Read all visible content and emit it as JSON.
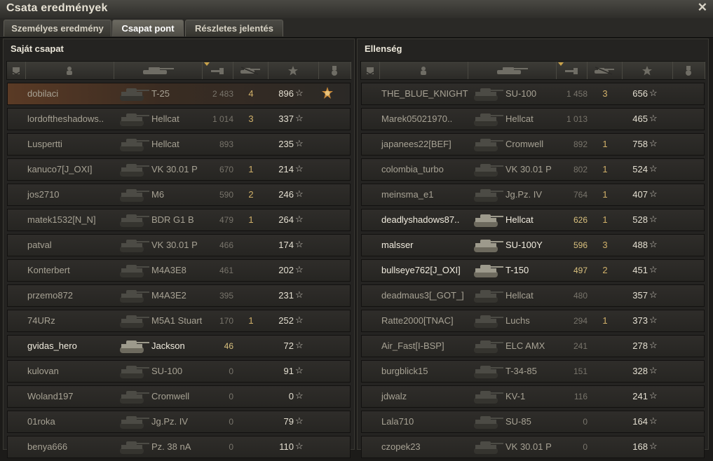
{
  "window": {
    "title": "Csata eredmények",
    "close_icon": "close-icon"
  },
  "tabs": [
    {
      "label": "Személyes eredmény",
      "active": false
    },
    {
      "label": "Csapat pont",
      "active": true
    },
    {
      "label": "Részletes jelentés",
      "active": false
    }
  ],
  "columns": {
    "icons": [
      "rank-icon",
      "player-icon",
      "tank-icon",
      "damage-icon",
      "kills-icon",
      "experience-star-icon",
      "medal-icon"
    ],
    "sorted_by": "damage-icon"
  },
  "colors": {
    "accent": "#c9a24a",
    "alive_text": "#f1ecdf",
    "dead_text": "#a7a294",
    "first_row": "#5a3a25"
  },
  "own_team": {
    "title": "Saját csapat",
    "players": [
      {
        "name": "dobilaci",
        "tank": "T-25",
        "damage": "2 483",
        "frags": "4",
        "xp": "896",
        "alive": false,
        "first": true,
        "medal": true
      },
      {
        "name": "lordoftheshadows..",
        "tank": "Hellcat",
        "damage": "1 014",
        "frags": "3",
        "xp": "337",
        "alive": false
      },
      {
        "name": "Luspertti",
        "tank": "Hellcat",
        "damage": "893",
        "frags": "",
        "xp": "235",
        "alive": false
      },
      {
        "name": "kanuco7[J_OXI]",
        "tank": "VK 30.01 P",
        "damage": "670",
        "frags": "1",
        "xp": "214",
        "alive": false
      },
      {
        "name": "jos2710",
        "tank": "M6",
        "damage": "590",
        "frags": "2",
        "xp": "246",
        "alive": false
      },
      {
        "name": "matek1532[N_N]",
        "tank": "BDR G1 B",
        "damage": "479",
        "frags": "1",
        "xp": "264",
        "alive": false
      },
      {
        "name": "patval",
        "tank": "VK 30.01 P",
        "damage": "466",
        "frags": "",
        "xp": "174",
        "alive": false
      },
      {
        "name": "Konterbert",
        "tank": "M4A3E8",
        "damage": "461",
        "frags": "",
        "xp": "202",
        "alive": false
      },
      {
        "name": "przemo872",
        "tank": "M4A3E2",
        "damage": "395",
        "frags": "",
        "xp": "231",
        "alive": false
      },
      {
        "name": "74URz",
        "tank": "M5A1 Stuart",
        "damage": "170",
        "frags": "1",
        "xp": "252",
        "alive": false
      },
      {
        "name": "gvidas_hero",
        "tank": "Jackson",
        "damage": "46",
        "frags": "",
        "xp": "72",
        "alive": true
      },
      {
        "name": "kulovan",
        "tank": "SU-100",
        "damage": "0",
        "frags": "",
        "xp": "91",
        "alive": false
      },
      {
        "name": "Woland197",
        "tank": "Cromwell",
        "damage": "0",
        "frags": "",
        "xp": "0",
        "alive": false
      },
      {
        "name": "01roka",
        "tank": "Jg.Pz. IV",
        "damage": "0",
        "frags": "",
        "xp": "79",
        "alive": false
      },
      {
        "name": "benya666",
        "tank": "Pz. 38 nA",
        "damage": "0",
        "frags": "",
        "xp": "110",
        "alive": false
      }
    ]
  },
  "enemy_team": {
    "title": "Ellenség",
    "players": [
      {
        "name": "THE_BLUE_KNIGHT",
        "tank": "SU-100",
        "damage": "1 458",
        "frags": "3",
        "xp": "656",
        "alive": false
      },
      {
        "name": "Marek05021970..",
        "tank": "Hellcat",
        "damage": "1 013",
        "frags": "",
        "xp": "465",
        "alive": false
      },
      {
        "name": "japanees22[BEF]",
        "tank": "Cromwell",
        "damage": "892",
        "frags": "1",
        "xp": "758",
        "alive": false
      },
      {
        "name": "colombia_turbo",
        "tank": "VK 30.01 P",
        "damage": "802",
        "frags": "1",
        "xp": "524",
        "alive": false
      },
      {
        "name": "meinsma_e1",
        "tank": "Jg.Pz. IV",
        "damage": "764",
        "frags": "1",
        "xp": "407",
        "alive": false
      },
      {
        "name": "deadlyshadows87..",
        "tank": "Hellcat",
        "damage": "626",
        "frags": "1",
        "xp": "528",
        "alive": true
      },
      {
        "name": "malsser",
        "tank": "SU-100Y",
        "damage": "596",
        "frags": "3",
        "xp": "488",
        "alive": true
      },
      {
        "name": "bullseye762[J_OXI]",
        "tank": "T-150",
        "damage": "497",
        "frags": "2",
        "xp": "451",
        "alive": true
      },
      {
        "name": "deadmaus3[_GOT_]",
        "tank": "Hellcat",
        "damage": "480",
        "frags": "",
        "xp": "357",
        "alive": false
      },
      {
        "name": "Ratte2000[TNAC]",
        "tank": "Luchs",
        "damage": "294",
        "frags": "1",
        "xp": "373",
        "alive": false
      },
      {
        "name": "Air_Fast[I-BSP]",
        "tank": "ELC AMX",
        "damage": "241",
        "frags": "",
        "xp": "278",
        "alive": false
      },
      {
        "name": "burgblick15",
        "tank": "T-34-85",
        "damage": "151",
        "frags": "",
        "xp": "328",
        "alive": false
      },
      {
        "name": "jdwalz",
        "tank": "KV-1",
        "damage": "116",
        "frags": "",
        "xp": "241",
        "alive": false
      },
      {
        "name": "Lala710",
        "tank": "SU-85",
        "damage": "0",
        "frags": "",
        "xp": "164",
        "alive": false
      },
      {
        "name": "czopek23",
        "tank": "VK 30.01 P",
        "damage": "0",
        "frags": "",
        "xp": "168",
        "alive": false
      }
    ]
  }
}
